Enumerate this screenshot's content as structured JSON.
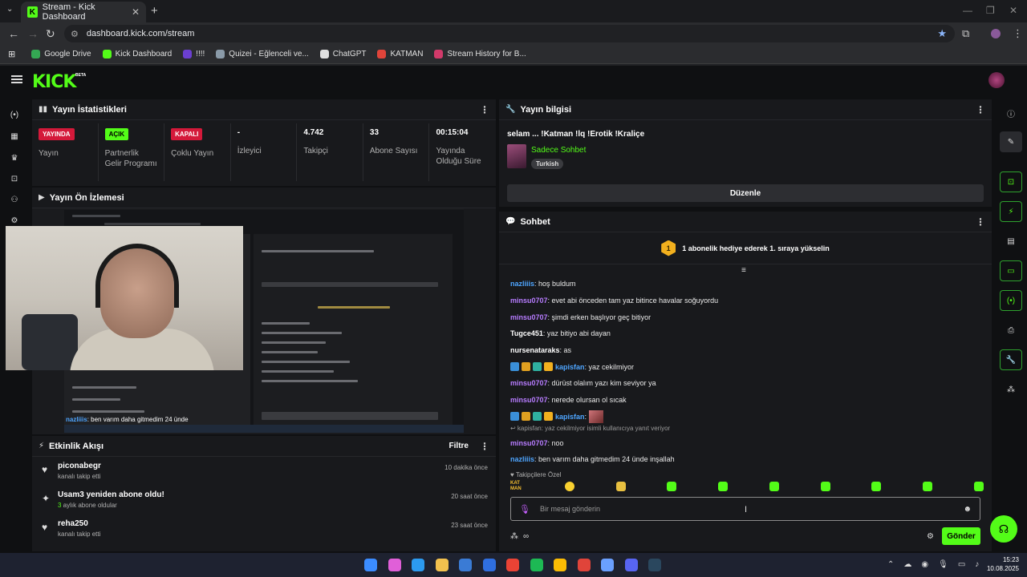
{
  "browser": {
    "tab_title": "Stream - Kick Dashboard",
    "tab_favicon": "K",
    "url": "dashboard.kick.com/stream",
    "bookmarks": [
      {
        "label": "Google Drive",
        "color": "#34a853"
      },
      {
        "label": "Kick Dashboard",
        "color": "#53fc18"
      },
      {
        "label": "!!!!",
        "color": "#6b3fd0"
      },
      {
        "label": "Quizei - Eğlenceli ve...",
        "color": "#8a9aa8"
      },
      {
        "label": "ChatGPT",
        "color": "#e0e0e0"
      },
      {
        "label": "KATMAN",
        "color": "#e0443a"
      },
      {
        "label": "Stream History for B...",
        "color": "#d13a6a"
      }
    ]
  },
  "app": {
    "logo": "KICK",
    "beta": "BETA"
  },
  "stats_panel": {
    "title": "Yayın İstatistikleri",
    "items": [
      {
        "badge": "YAYINDA",
        "badge_style": "red",
        "value": "",
        "label": "Yayın"
      },
      {
        "badge": "AÇIK",
        "badge_style": "green",
        "value": "",
        "label": "Partnerlik Gelir Programı"
      },
      {
        "badge": "KAPALI",
        "badge_style": "red",
        "value": "",
        "label": "Çoklu Yayın"
      },
      {
        "badge": "",
        "badge_style": "",
        "value": "-",
        "label": "İzleyici"
      },
      {
        "badge": "",
        "badge_style": "",
        "value": "4.742",
        "label": "Takipçi"
      },
      {
        "badge": "",
        "badge_style": "",
        "value": "33",
        "label": "Abone Sayısı"
      },
      {
        "badge": "",
        "badge_style": "",
        "value": "00:15:04",
        "label": "Yayında Olduğu Süre"
      }
    ]
  },
  "preview_panel": {
    "title": "Yayın Ön İzlemesi",
    "overlay_user": "nazliiis",
    "overlay_text": ": ben varım daha gitmedim 24 ünde"
  },
  "activity_panel": {
    "title": "Etkinlik Akışı",
    "filter_label": "Filtre",
    "items": [
      {
        "icon": "heart-icon",
        "glyph": "♥",
        "title": "piconabegr",
        "sub_num": "",
        "sub": "kanalı takip etti",
        "time": "10 dakika önce"
      },
      {
        "icon": "sparkle-icon",
        "glyph": "✦",
        "title": "Usam3 yeniden abone oldu!",
        "sub_num": "3",
        "sub": " aylık abone oldular",
        "time": "20 saat önce"
      },
      {
        "icon": "heart-icon",
        "glyph": "♥",
        "title": "reha250",
        "sub_num": "",
        "sub": "kanalı takip etti",
        "time": "23 saat önce"
      }
    ]
  },
  "info_panel": {
    "title": "Yayın bilgisi",
    "stream_title": "selam ... !Katman !lq !Erotik !Kraliçe",
    "category": "Sadece Sohbet",
    "tag": "Turkish",
    "edit_label": "Düzenle"
  },
  "chat_panel": {
    "title": "Sohbet",
    "gift_rank": "1",
    "gift_text": "1 abonelik hediye ederek 1. sıraya yükselin",
    "messages": [
      {
        "user": "nazliiis",
        "color": "blue",
        "badges": 0,
        "text": ": hoş buldum"
      },
      {
        "user": "minsu0707",
        "color": "purple",
        "badges": 0,
        "text": ": evet abi önceden tam yaz bitince havalar soğuyordu"
      },
      {
        "user": "minsu0707",
        "color": "purple",
        "badges": 0,
        "text": ": şimdi erken başlıyor geç bitiyor"
      },
      {
        "user": "Tugce451",
        "color": "white",
        "badges": 0,
        "text": ": yaz bitiyo abi dayan"
      },
      {
        "user": "nursenataraks",
        "color": "white",
        "badges": 0,
        "text": ": as"
      },
      {
        "user": "kapisfan",
        "color": "blue",
        "badges": 4,
        "text": ": yaz cekilmiyor"
      },
      {
        "user": "minsu0707",
        "color": "purple",
        "badges": 0,
        "text": ": dürüst olalım yazı kim seviyor ya"
      },
      {
        "user": "minsu0707",
        "color": "purple",
        "badges": 0,
        "text": ": nerede olursan ol sıcak"
      },
      {
        "user": "kapisfan",
        "color": "blue",
        "badges": 4,
        "text": ":",
        "emote": true
      }
    ],
    "reply_note": "↩ kapisfan: yaz cekilmiyor isimli kullanıcıya yanıt veriyor",
    "messages_after": [
      {
        "user": "minsu0707",
        "color": "purple",
        "text": ": noo"
      },
      {
        "user": "nazliiis",
        "color": "blue",
        "text": ": ben varım daha gitmedim 24 ünde inşallah"
      }
    ],
    "followers_only": "♥ Takipçilere Özel",
    "emote_kat": "KAT MAN",
    "input_placeholder": "Bir mesaj gönderin",
    "send_label": "Gönder"
  },
  "taskbar": {
    "time": "15:23",
    "date": "10.08.2025",
    "icons": [
      "#3b8cff",
      "#e05fd8",
      "#2c9bf0",
      "#f2c14e",
      "#3a7bd5",
      "#2f6fe0",
      "#ea4335",
      "#1db954",
      "#fbbc04",
      "#e0443a",
      "#6aa0ff",
      "#5865f2",
      "#2a475e"
    ]
  }
}
